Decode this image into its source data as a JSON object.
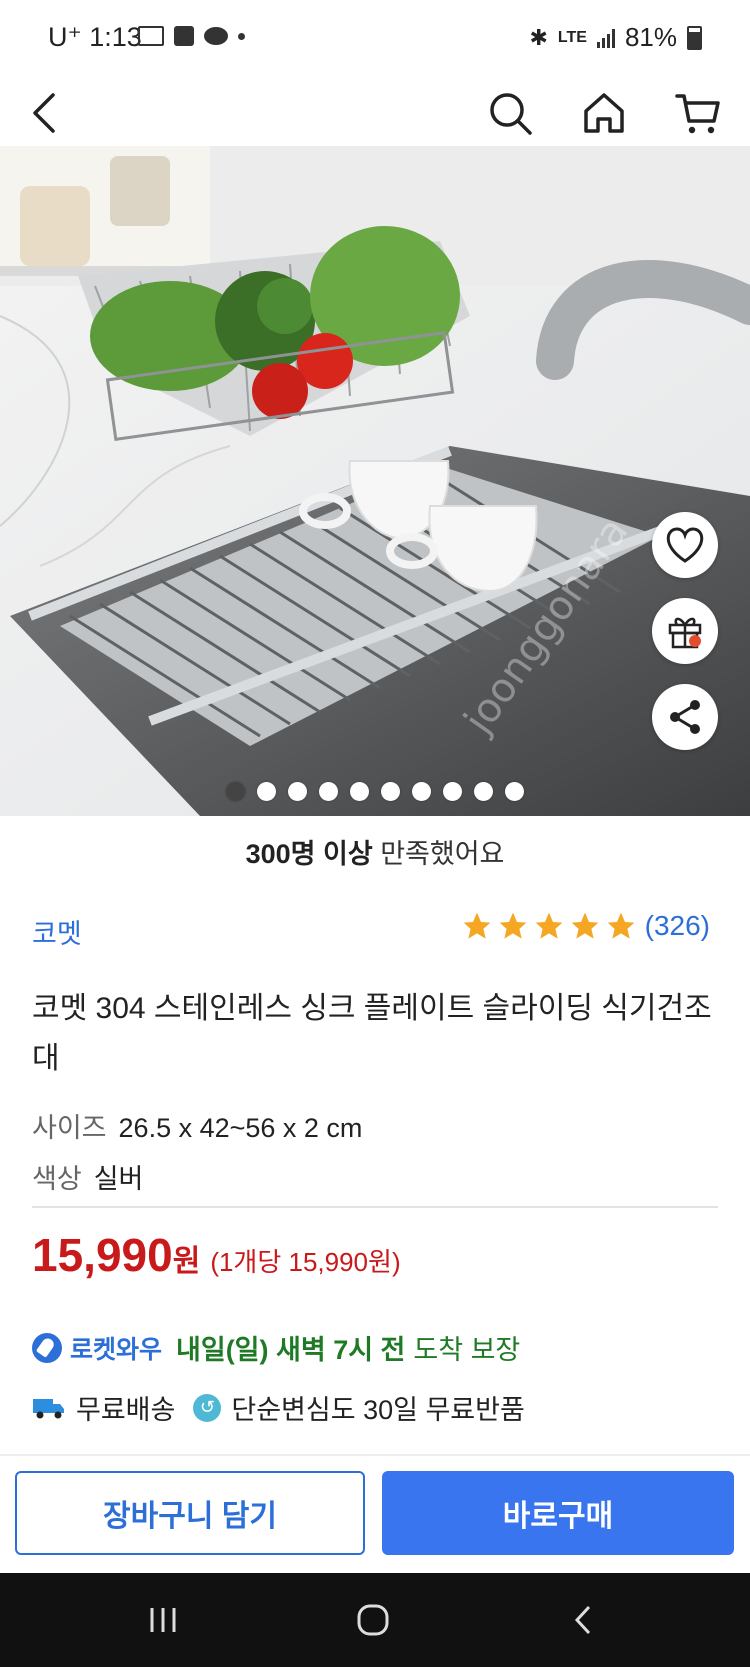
{
  "status_bar": {
    "carrier": "U⁺",
    "time": "1:13",
    "network": "LTE",
    "battery": "81%"
  },
  "nav": {
    "back_icon": "chevron-left-icon",
    "search_icon": "search-icon",
    "home_icon": "home-icon",
    "cart_icon": "cart-icon"
  },
  "hero": {
    "slide_count": 10,
    "active_index": 0,
    "watermark": "joonggonara"
  },
  "floating": {
    "wish_icon": "heart-icon",
    "gift_icon": "gift-icon",
    "share_icon": "share-icon"
  },
  "satisfaction": {
    "bold": "300명 이상",
    "text": " 만족했어요"
  },
  "product": {
    "brand": "코멧",
    "rating": 5,
    "review_count": "(326)",
    "title": "코멧 304 스테인레스 싱크 플레이트 슬라이딩 식기건조대",
    "specs": [
      {
        "key": "사이즈",
        "value": "26.5 x 42~56 x 2 cm"
      },
      {
        "key": "색상",
        "value": "실버"
      }
    ],
    "price": "15,990",
    "price_unit": "원",
    "unit_price": "(1개당 15,990원)"
  },
  "delivery": {
    "rocket_label": "로켓와우",
    "arrival_bold": "내일(일) 새벽 7시 전",
    "arrival_text": "도착 보장",
    "free_shipping": "무료배송",
    "return_text": "단순변심도 30일 무료반품"
  },
  "actions": {
    "cart": "장바구니 담기",
    "buy": "바로구매"
  },
  "colors": {
    "accent": "#2d6fd8",
    "price": "#c8191b",
    "buy_button": "#3a75f0",
    "star": "#f5a623"
  }
}
